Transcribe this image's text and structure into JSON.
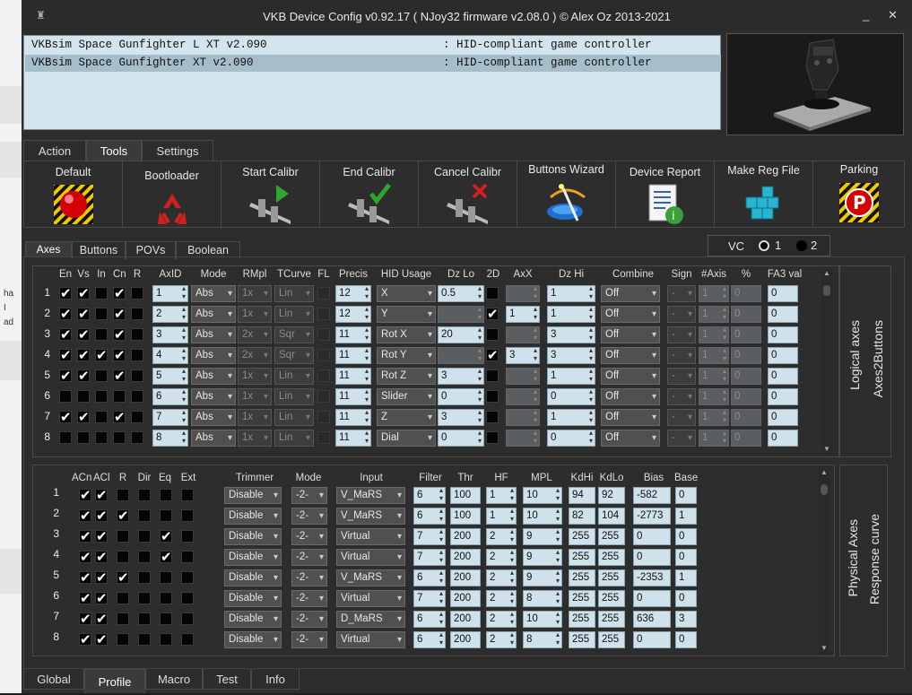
{
  "title": "VKB Device Config v0.92.17 ( NJoy32 firmware v2.08.0 ) © Alex Oz 2013-2021",
  "window_buttons": {
    "minimize": "_",
    "close": "✕"
  },
  "background_text": [
    "ha",
    "I",
    "ad"
  ],
  "devices": [
    {
      "name": "VKBsim Space Gunfighter L XT v2.090",
      "type": ": HID-compliant game controller"
    },
    {
      "name": "VKBsim Space Gunfighter XT v2.090",
      "type": ": HID-compliant game controller"
    }
  ],
  "main_tabs": [
    "Action",
    "Tools",
    "Settings"
  ],
  "tools": [
    "Default",
    "Bootloader",
    "Start Calibr",
    "End Calibr",
    "Cancel Calibr",
    "Buttons Wizard",
    "Device Report",
    "Make Reg File",
    "Parking"
  ],
  "sub_tabs": [
    "Axes",
    "Buttons",
    "POVs",
    "Boolean"
  ],
  "vc": {
    "label": "VC",
    "opt1": "1",
    "opt2": "2",
    "selected": "1"
  },
  "logical": {
    "headers": {
      "en": "En",
      "vs": "Vs",
      "in": "In",
      "cn": "Cn",
      "r": "R",
      "axid": "AxID",
      "mode": "Mode",
      "rmpl": "RMpl",
      "tcurve": "TCurve",
      "fl": "FL",
      "precis": "Precis",
      "hid": "HID Usage",
      "dzlo": "Dz Lo",
      "2d": "2D",
      "axx": "AxX",
      "dzhi": "Dz Hi",
      "combine": "Combine",
      "sign": "Sign",
      "naxis": "#Axis",
      "pct": "%",
      "fa3": "FA3 val"
    },
    "rows": [
      {
        "n": "1",
        "en": 1,
        "vs": 1,
        "in": 0,
        "cn": 1,
        "r": 0,
        "axid": "1",
        "mode": "Abs",
        "rmpl": "1x",
        "tc": "Lin",
        "fl": 0,
        "precis": "12",
        "hid": "X",
        "dzlo": "0.5",
        "dzlo_en": 1,
        "d2": 0,
        "axx": "",
        "axx_en": 0,
        "dzhi": "1",
        "combine": "Off",
        "sign": "-",
        "naxis": "1",
        "pct": "0",
        "fa3": "0"
      },
      {
        "n": "2",
        "en": 1,
        "vs": 1,
        "in": 0,
        "cn": 1,
        "r": 0,
        "axid": "2",
        "mode": "Abs",
        "rmpl": "1x",
        "tc": "Lin",
        "fl": 0,
        "precis": "12",
        "hid": "Y",
        "dzlo": "",
        "dzlo_en": 0,
        "d2": 1,
        "axx": "1",
        "axx_en": 1,
        "dzhi": "1",
        "combine": "Off",
        "sign": "-",
        "naxis": "1",
        "pct": "0",
        "fa3": "0"
      },
      {
        "n": "3",
        "en": 1,
        "vs": 1,
        "in": 0,
        "cn": 1,
        "r": 0,
        "axid": "3",
        "mode": "Abs",
        "rmpl": "2x",
        "tc": "Sqr",
        "fl": 0,
        "precis": "11",
        "hid": "Rot X",
        "dzlo": "20",
        "dzlo_en": 1,
        "d2": 0,
        "axx": "",
        "axx_en": 0,
        "dzhi": "3",
        "combine": "Off",
        "sign": "-",
        "naxis": "1",
        "pct": "0",
        "fa3": "0"
      },
      {
        "n": "4",
        "en": 1,
        "vs": 1,
        "in": 1,
        "cn": 1,
        "r": 0,
        "axid": "4",
        "mode": "Abs",
        "rmpl": "2x",
        "tc": "Sqr",
        "fl": 0,
        "precis": "11",
        "hid": "Rot Y",
        "dzlo": "",
        "dzlo_en": 0,
        "d2": 1,
        "axx": "3",
        "axx_en": 1,
        "dzhi": "3",
        "combine": "Off",
        "sign": "-",
        "naxis": "1",
        "pct": "0",
        "fa3": "0"
      },
      {
        "n": "5",
        "en": 1,
        "vs": 1,
        "in": 0,
        "cn": 1,
        "r": 0,
        "axid": "5",
        "mode": "Abs",
        "rmpl": "1x",
        "tc": "Lin",
        "fl": 0,
        "precis": "11",
        "hid": "Rot Z",
        "dzlo": "3",
        "dzlo_en": 1,
        "d2": 0,
        "axx": "",
        "axx_en": 0,
        "dzhi": "1",
        "combine": "Off",
        "sign": "-",
        "naxis": "1",
        "pct": "0",
        "fa3": "0"
      },
      {
        "n": "6",
        "en": 0,
        "vs": 0,
        "in": 0,
        "cn": 0,
        "r": 0,
        "axid": "6",
        "mode": "Abs",
        "rmpl": "1x",
        "tc": "Lin",
        "fl": 0,
        "precis": "11",
        "hid": "Slider",
        "dzlo": "0",
        "dzlo_en": 1,
        "d2": 0,
        "axx": "",
        "axx_en": 0,
        "dzhi": "0",
        "combine": "Off",
        "sign": "-",
        "naxis": "1",
        "pct": "0",
        "fa3": "0"
      },
      {
        "n": "7",
        "en": 1,
        "vs": 1,
        "in": 0,
        "cn": 1,
        "r": 0,
        "axid": "7",
        "mode": "Abs",
        "rmpl": "1x",
        "tc": "Lin",
        "fl": 0,
        "precis": "11",
        "hid": "Z",
        "dzlo": "3",
        "dzlo_en": 1,
        "d2": 0,
        "axx": "",
        "axx_en": 0,
        "dzhi": "1",
        "combine": "Off",
        "sign": "-",
        "naxis": "1",
        "pct": "0",
        "fa3": "0"
      },
      {
        "n": "8",
        "en": 0,
        "vs": 0,
        "in": 0,
        "cn": 0,
        "r": 0,
        "axid": "8",
        "mode": "Abs",
        "rmpl": "1x",
        "tc": "Lin",
        "fl": 0,
        "precis": "11",
        "hid": "Dial",
        "dzlo": "0",
        "dzlo_en": 1,
        "d2": 0,
        "axx": "",
        "axx_en": 0,
        "dzhi": "0",
        "combine": "Off",
        "sign": "-",
        "naxis": "1",
        "pct": "0",
        "fa3": "0"
      }
    ],
    "side_labels": [
      "Logical axes",
      "Axes2Buttons"
    ]
  },
  "physical": {
    "headers": {
      "acn": "ACn",
      "acl": "ACl",
      "r": "R",
      "dir": "Dir",
      "eq": "Eq",
      "ext": "Ext",
      "trimmer": "Trimmer",
      "mode": "Mode",
      "input": "Input",
      "filter": "Filter",
      "thr": "Thr",
      "hf": "HF",
      "mpl": "MPL",
      "kdhi": "KdHi",
      "kdlo": "KdLo",
      "bias": "Bias",
      "base": "Base"
    },
    "rows": [
      {
        "n": "1",
        "acn": 1,
        "acl": 1,
        "r": 0,
        "dir": 0,
        "eq": 0,
        "ext": 0,
        "trimmer": "Disable",
        "mode": "-2-",
        "input": "V_MaRS",
        "filter": "6",
        "thr": "100",
        "hf": "1",
        "mpl": "10",
        "kdhi": "94",
        "kdlo": "92",
        "bias": "-582",
        "base": "0"
      },
      {
        "n": "2",
        "acn": 1,
        "acl": 1,
        "r": 1,
        "dir": 0,
        "eq": 0,
        "ext": 0,
        "trimmer": "Disable",
        "mode": "-2-",
        "input": "V_MaRS",
        "filter": "6",
        "thr": "100",
        "hf": "1",
        "mpl": "10",
        "kdhi": "82",
        "kdlo": "104",
        "bias": "-2773",
        "base": "1"
      },
      {
        "n": "3",
        "acn": 1,
        "acl": 1,
        "r": 0,
        "dir": 0,
        "eq": 1,
        "ext": 0,
        "trimmer": "Disable",
        "mode": "-2-",
        "input": "Virtual",
        "filter": "7",
        "thr": "200",
        "hf": "2",
        "mpl": "9",
        "kdhi": "255",
        "kdlo": "255",
        "bias": "0",
        "base": "0"
      },
      {
        "n": "4",
        "acn": 1,
        "acl": 1,
        "r": 0,
        "dir": 0,
        "eq": 1,
        "ext": 0,
        "trimmer": "Disable",
        "mode": "-2-",
        "input": "Virtual",
        "filter": "7",
        "thr": "200",
        "hf": "2",
        "mpl": "9",
        "kdhi": "255",
        "kdlo": "255",
        "bias": "0",
        "base": "0"
      },
      {
        "n": "5",
        "acn": 1,
        "acl": 1,
        "r": 1,
        "dir": 0,
        "eq": 0,
        "ext": 0,
        "trimmer": "Disable",
        "mode": "-2-",
        "input": "V_MaRS",
        "filter": "6",
        "thr": "200",
        "hf": "2",
        "mpl": "9",
        "kdhi": "255",
        "kdlo": "255",
        "bias": "-2353",
        "base": "1"
      },
      {
        "n": "6",
        "acn": 1,
        "acl": 1,
        "r": 0,
        "dir": 0,
        "eq": 0,
        "ext": 0,
        "trimmer": "Disable",
        "mode": "-2-",
        "input": "Virtual",
        "filter": "7",
        "thr": "200",
        "hf": "2",
        "mpl": "8",
        "kdhi": "255",
        "kdlo": "255",
        "bias": "0",
        "base": "0"
      },
      {
        "n": "7",
        "acn": 1,
        "acl": 1,
        "r": 0,
        "dir": 0,
        "eq": 0,
        "ext": 0,
        "trimmer": "Disable",
        "mode": "-2-",
        "input": "D_MaRS",
        "filter": "6",
        "thr": "200",
        "hf": "2",
        "mpl": "10",
        "kdhi": "255",
        "kdlo": "255",
        "bias": "636",
        "base": "3"
      },
      {
        "n": "8",
        "acn": 1,
        "acl": 1,
        "r": 0,
        "dir": 0,
        "eq": 0,
        "ext": 0,
        "trimmer": "Disable",
        "mode": "-2-",
        "input": "Virtual",
        "filter": "6",
        "thr": "200",
        "hf": "2",
        "mpl": "8",
        "kdhi": "255",
        "kdlo": "255",
        "bias": "0",
        "base": "0"
      }
    ],
    "side_labels": [
      "Physical Axes",
      "Response curve"
    ]
  },
  "bottom_tabs": [
    "Global",
    "Profile",
    "Macro",
    "Test",
    "Info"
  ],
  "selected": {
    "main_tab": "Tools",
    "sub_tab": "Axes",
    "bottom_tab": "Profile",
    "device_row": 1
  }
}
